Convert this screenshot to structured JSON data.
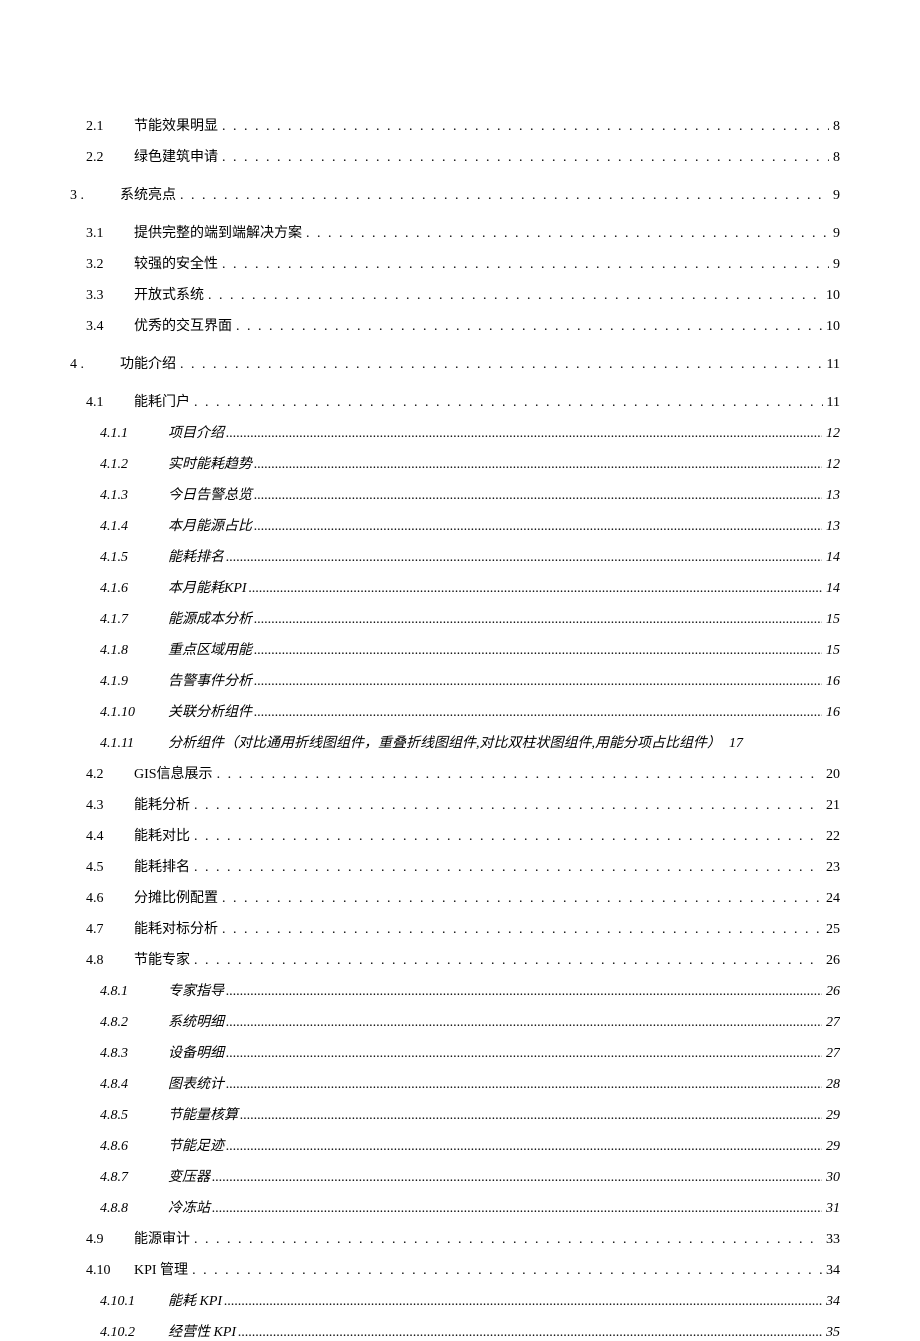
{
  "toc": [
    {
      "level": 2,
      "num": "2.1",
      "label": "节能效果明显",
      "page": "8",
      "dots": "loose"
    },
    {
      "level": 2,
      "num": "2.2",
      "label": "绿色建筑申请",
      "page": "8",
      "dots": "loose"
    },
    {
      "level": 1,
      "num": "3 .",
      "label": "系统亮点",
      "page": "9",
      "dots": "loose"
    },
    {
      "level": 2,
      "num": "3.1",
      "label": "提供完整的端到端解决方案",
      "page": "9",
      "dots": "loose"
    },
    {
      "level": 2,
      "num": "3.2",
      "label": "较强的安全性",
      "page": "9",
      "dots": "loose"
    },
    {
      "level": 2,
      "num": "3.3",
      "label": "开放式系统",
      "page": "10",
      "dots": "loose"
    },
    {
      "level": 2,
      "num": "3.4",
      "label": "优秀的交互界面",
      "page": "10",
      "dots": "loose"
    },
    {
      "level": 1,
      "num": "4 .",
      "label": "功能介绍",
      "page": "11",
      "dots": "loose"
    },
    {
      "level": 2,
      "num": "4.1",
      "label": "能耗门户",
      "page": "11",
      "dots": "loose"
    },
    {
      "level": 3,
      "num": "4.1.1",
      "label": "项目介绍",
      "page": "12",
      "dots": "tight"
    },
    {
      "level": 3,
      "num": "4.1.2",
      "label": "实时能耗趋势",
      "page": "12",
      "dots": "tight"
    },
    {
      "level": 3,
      "num": "4.1.3",
      "label": "今日告警总览",
      "page": "13",
      "dots": "tight"
    },
    {
      "level": 3,
      "num": "4.1.4",
      "label": "本月能源占比",
      "page": "13",
      "dots": "tight"
    },
    {
      "level": 3,
      "num": "4.1.5",
      "label": "能耗排名",
      "page": "14",
      "dots": "tight"
    },
    {
      "level": 3,
      "num": "4.1.6",
      "label": "本月能耗KPI",
      "page": "14",
      "dots": "tight"
    },
    {
      "level": 3,
      "num": "4.1.7",
      "label": "能源成本分析",
      "page": "15",
      "dots": "tight"
    },
    {
      "level": 3,
      "num": "4.1.8",
      "label": "重点区域用能",
      "page": "15",
      "dots": "tight"
    },
    {
      "level": 3,
      "num": "4.1.9",
      "label": "告警事件分析",
      "page": "16",
      "dots": "tight"
    },
    {
      "level": 3,
      "num": "4.1.10",
      "label": "关联分析组件",
      "page": "16",
      "dots": "tight"
    },
    {
      "level": 3,
      "num": "4.1.11",
      "label": "分析组件（对比通用折线图组件，重叠折线图组件,对比双柱状图组件,用能分项占比组件）",
      "page": "17",
      "dots": "none"
    },
    {
      "level": 2,
      "num": "4.2",
      "label": "GIS信息展示",
      "page": "20",
      "dots": "loose"
    },
    {
      "level": 2,
      "num": "4.3",
      "label": "能耗分析",
      "page": "21",
      "dots": "loose"
    },
    {
      "level": 2,
      "num": "4.4",
      "label": "能耗对比",
      "page": "22",
      "dots": "loose"
    },
    {
      "level": 2,
      "num": "4.5",
      "label": "能耗排名",
      "page": "23",
      "dots": "loose"
    },
    {
      "level": 2,
      "num": "4.6",
      "label": "分摊比例配置",
      "page": "24",
      "dots": "loose"
    },
    {
      "level": 2,
      "num": "4.7",
      "label": "能耗对标分析",
      "page": "25",
      "dots": "loose"
    },
    {
      "level": 2,
      "num": "4.8",
      "label": "节能专家",
      "page": "26",
      "dots": "loose"
    },
    {
      "level": 3,
      "num": "4.8.1",
      "label": "专家指导",
      "page": "26",
      "dots": "tight"
    },
    {
      "level": 3,
      "num": "4.8.2",
      "label": "系统明细",
      "page": "27",
      "dots": "tight"
    },
    {
      "level": 3,
      "num": "4.8.3",
      "label": "设备明细",
      "page": "27",
      "dots": "tight"
    },
    {
      "level": 3,
      "num": "4.8.4",
      "label": "图表统计",
      "page": "28",
      "dots": "tight"
    },
    {
      "level": 3,
      "num": "4.8.5",
      "label": "节能量核算",
      "page": "29",
      "dots": "tight"
    },
    {
      "level": 3,
      "num": "4.8.6",
      "label": "节能足迹",
      "page": "29",
      "dots": "tight"
    },
    {
      "level": 3,
      "num": "4.8.7",
      "label": "变压器",
      "page": "30",
      "dots": "tight"
    },
    {
      "level": 3,
      "num": "4.8.8",
      "label": "冷冻站",
      "page": "31",
      "dots": "tight"
    },
    {
      "level": 2,
      "num": "4.9",
      "label": "能源审计",
      "page": "33",
      "dots": "loose"
    },
    {
      "level": 2,
      "num": "4.10",
      "label": "KPI 管理",
      "page": "34",
      "dots": "loose"
    },
    {
      "level": 3,
      "num": "4.10.1",
      "label": "能耗 KPI",
      "page": "34",
      "dots": "tight"
    },
    {
      "level": 3,
      "num": "4.10.2",
      "label": "经营性 KPI",
      "page": "35",
      "dots": "tight"
    }
  ]
}
